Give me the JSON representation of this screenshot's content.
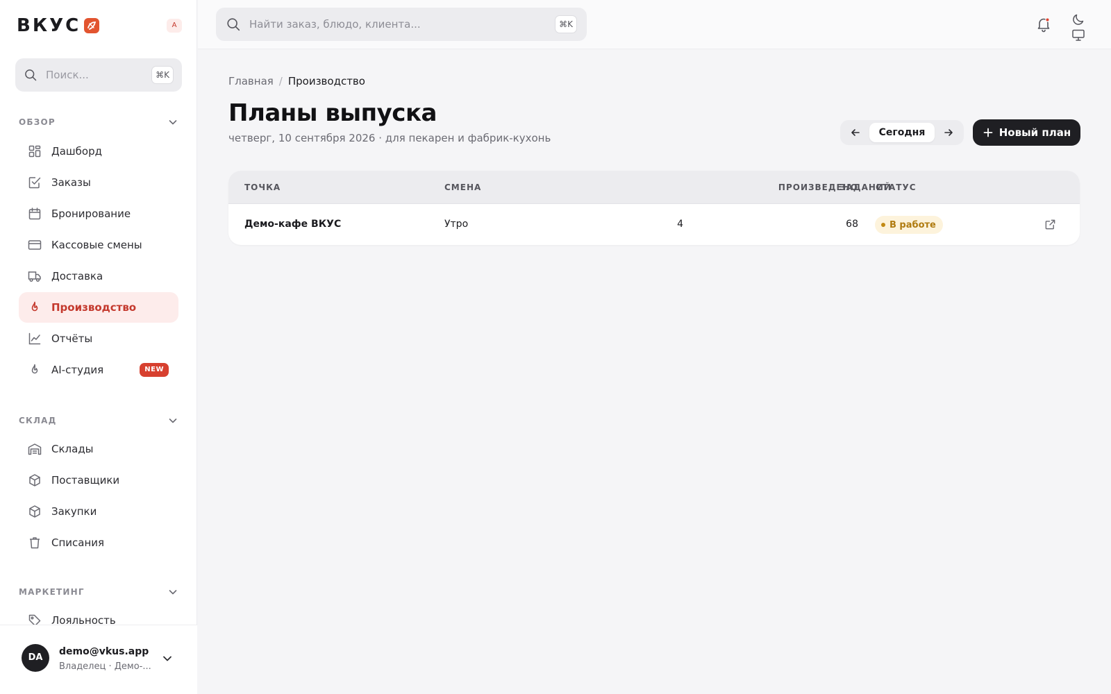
{
  "brand": {
    "name": "ВКУС",
    "badge": "A",
    "accent": "#e2542f"
  },
  "sidebar": {
    "search": {
      "placeholder": "Поиск...",
      "shortcut": "⌘K"
    },
    "sections": [
      {
        "title": "ОБЗОР",
        "items": [
          {
            "label": "Дашборд",
            "icon": "dashboard-icon"
          },
          {
            "label": "Заказы",
            "icon": "orders-icon"
          },
          {
            "label": "Бронирование",
            "icon": "calendar-icon"
          },
          {
            "label": "Кассовые смены",
            "icon": "card-icon"
          },
          {
            "label": "Доставка",
            "icon": "truck-icon"
          },
          {
            "label": "Производство",
            "icon": "flame-icon",
            "active": true
          },
          {
            "label": "Отчёты",
            "icon": "chart-icon"
          },
          {
            "label": "AI-студия",
            "icon": "flame-icon",
            "badge": "NEW"
          }
        ]
      },
      {
        "title": "СКЛАД",
        "items": [
          {
            "label": "Склады",
            "icon": "warehouse-icon"
          },
          {
            "label": "Поставщики",
            "icon": "box-icon"
          },
          {
            "label": "Закупки",
            "icon": "box-icon"
          },
          {
            "label": "Списания",
            "icon": "trash-icon"
          }
        ]
      },
      {
        "title": "МАРКЕТИНГ",
        "items": [
          {
            "label": "Лояльность",
            "icon": "tag-icon"
          }
        ]
      }
    ]
  },
  "user": {
    "initials": "DA",
    "email": "demo@vkus.app",
    "role": "Владелец · Демо-..."
  },
  "topbar": {
    "search": {
      "placeholder": "Найти заказ, блюдо, клиента...",
      "shortcut": "⌘K"
    }
  },
  "breadcrumb": {
    "home": "Главная",
    "separator": "/",
    "current": "Производство"
  },
  "page": {
    "title": "Планы выпуска",
    "subtitle": "четверг, 10 сентября 2026 · для пекарен и фабрик-кухонь",
    "today_label": "Сегодня",
    "new_plan_label": "Новый план"
  },
  "table": {
    "headers": {
      "point": "ТОЧКА",
      "shift": "СМЕНА",
      "tasks": "ЗАДАНИЙ",
      "produced": "ПРОИЗВЕДЕНО",
      "status": "СТАТУС"
    },
    "rows": [
      {
        "point": "Демо-кафе ВКУС",
        "shift": "Утро",
        "tasks": "4",
        "produced": "68",
        "status": "В работе"
      }
    ]
  }
}
